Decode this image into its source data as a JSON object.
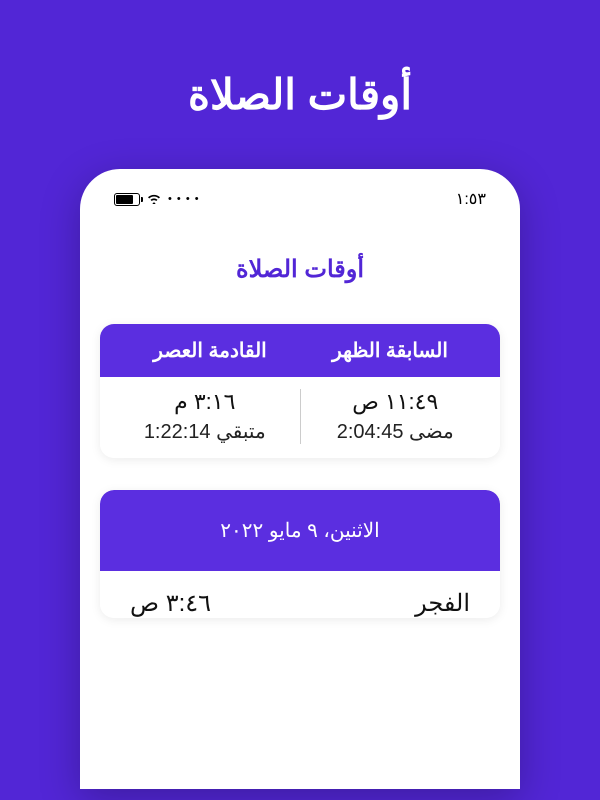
{
  "page": {
    "title": "أوقات الصلاة"
  },
  "statusBar": {
    "time": "١:٥٣",
    "dots": "• • • •"
  },
  "app": {
    "title": "أوقات الصلاة"
  },
  "prayerStatus": {
    "previous": {
      "label": "السابقة الظهر",
      "time": "١١:٤٩ ص",
      "elapsed": "مضى 2:04:45"
    },
    "next": {
      "label": "القادمة العصر",
      "time": "٣:١٦ م",
      "remaining": "متبقي 1:22:14"
    }
  },
  "dateHeader": "الاثنين، ٩ مايو ٢٠٢٢",
  "prayers": [
    {
      "name": "الفجر",
      "time": "٣:٤٦ ص"
    }
  ]
}
